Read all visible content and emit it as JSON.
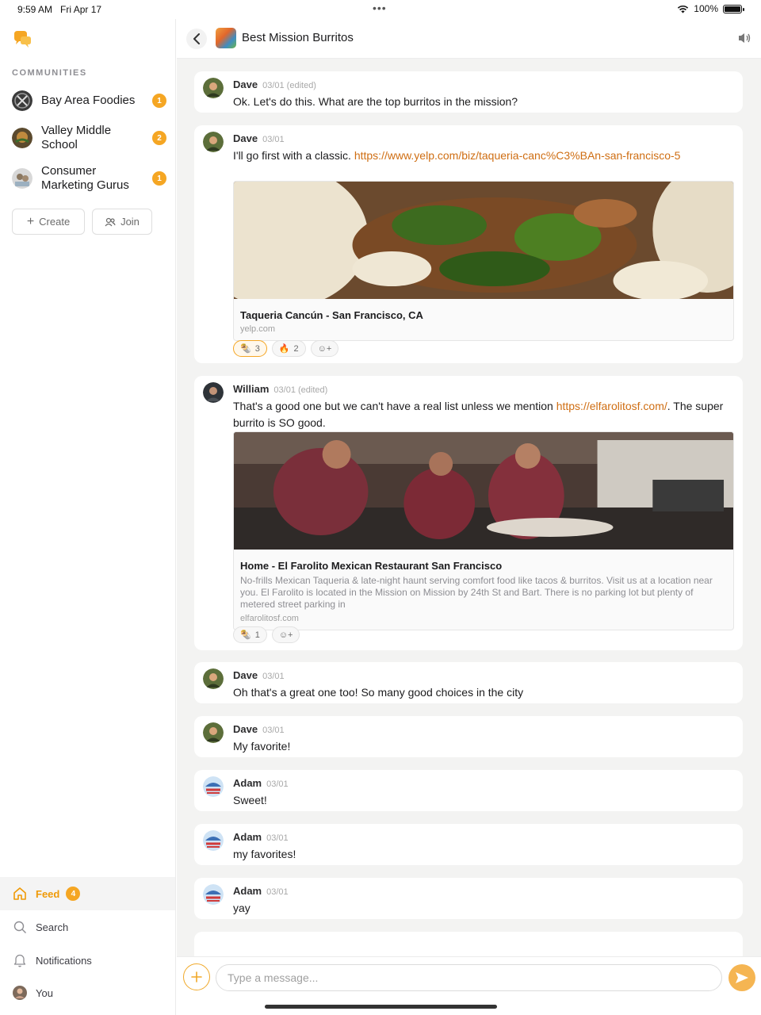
{
  "status_bar": {
    "time": "9:59 AM",
    "date": "Fri Apr 17",
    "battery": "100%"
  },
  "sidebar": {
    "section_label": "COMMUNITIES",
    "communities": [
      {
        "name": "Bay Area Foodies",
        "badge": "1"
      },
      {
        "name": "Valley Middle School",
        "badge": "2"
      },
      {
        "name": "Consumer Marketing Gurus",
        "badge": "1"
      }
    ],
    "create_label": "Create",
    "join_label": "Join",
    "nav": [
      {
        "label": "Feed",
        "icon": "home-icon",
        "badge": "4",
        "active": true
      },
      {
        "label": "Search",
        "icon": "search-icon"
      },
      {
        "label": "Notifications",
        "icon": "bell-icon"
      },
      {
        "label": "You",
        "icon": "avatar"
      }
    ]
  },
  "header": {
    "title": "Best Mission Burritos"
  },
  "messages": [
    {
      "author": "Dave",
      "meta": "03/01",
      "edited": "(edited)",
      "text": "Ok. Let's do this. What are the top burritos in the mission?"
    },
    {
      "author": "Dave",
      "meta": "03/01",
      "text_before": "I'll go first with a classic. ",
      "link": "https://www.yelp.com/biz/taqueria-canc%C3%BAn-san-francisco-5",
      "preview": {
        "title": "Taqueria Cancún - San Francisco, CA",
        "domain": "yelp.com"
      },
      "reactions": [
        {
          "emoji": "🌯",
          "count": "3",
          "mine": true
        },
        {
          "emoji": "🔥",
          "count": "2"
        }
      ]
    },
    {
      "author": "William",
      "meta": "03/01",
      "edited": "(edited)",
      "text_before": "That's a good one but we can't have a real list unless we mention ",
      "link": "https://elfarolitosf.com/",
      "text_after": ". The super burrito is SO good.",
      "preview": {
        "title": "Home - El Farolito Mexican Restaurant San Francisco",
        "description": "No-frills Mexican Taqueria & late-night haunt serving comfort food like tacos & burritos. Visit us at a location near you. El Farolito is located in the Mission on Mission by 24th St and Bart. There is no parking lot but plenty of metered street parking in",
        "domain": "elfarolitosf.com"
      },
      "reactions": [
        {
          "emoji": "🌯",
          "count": "1"
        }
      ]
    },
    {
      "author": "Dave",
      "meta": "03/01",
      "text": "Oh that's a great one too! So many good choices in the city"
    },
    {
      "author": "Dave",
      "meta": "03/01",
      "text": "My favorite!"
    },
    {
      "author": "Adam",
      "meta": "03/01",
      "text": "Sweet!"
    },
    {
      "author": "Adam",
      "meta": "03/01",
      "text": "my favorites!"
    },
    {
      "author": "Adam",
      "meta": "03/01",
      "text": "yay"
    }
  ],
  "composer": {
    "placeholder": "Type a message..."
  },
  "colors": {
    "accent": "#f5a623",
    "link": "#cf6e13"
  }
}
